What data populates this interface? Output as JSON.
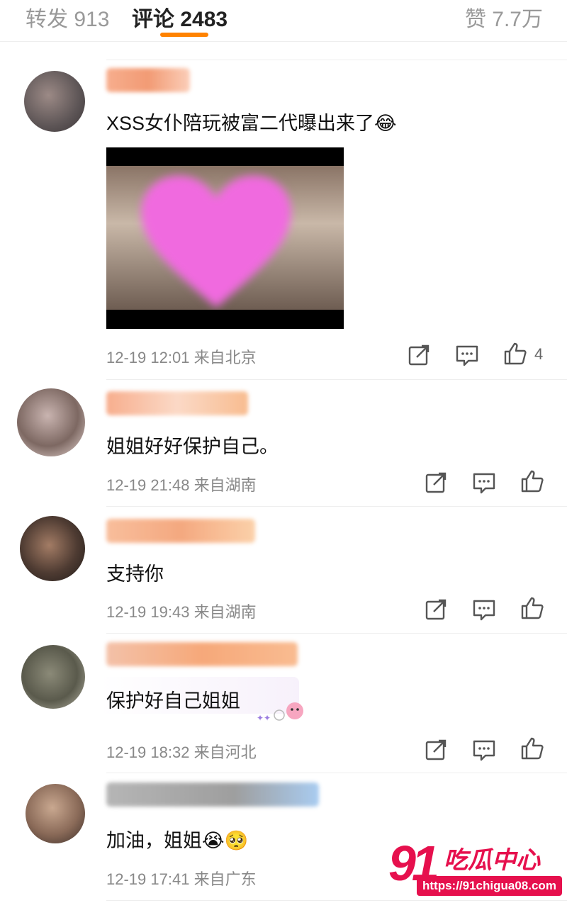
{
  "tabs": {
    "repost": "转发 913",
    "comments": "评论 2483",
    "likes": "赞 7.7万"
  },
  "comments": [
    {
      "text": "XSS女仆陪玩被富二代曝出来了😂",
      "time": "12-19 12:01",
      "location": "来自北京",
      "likes": "4"
    },
    {
      "text": "姐姐好好保护自己。",
      "time": "12-19 21:48",
      "location": "来自湖南",
      "likes": ""
    },
    {
      "text": "支持你",
      "time": "12-19 19:43",
      "location": "来自湖南",
      "likes": ""
    },
    {
      "text": "保护好自己姐姐",
      "time": "12-19 18:32",
      "location": "来自河北",
      "likes": ""
    },
    {
      "text": "加油，姐姐😭🥺",
      "time": "12-19 17:41",
      "location": "来自广东",
      "likes": ""
    }
  ],
  "icons": {
    "repost": "share-icon",
    "comment": "comment-icon",
    "like": "thumbs-up-icon"
  },
  "colors": {
    "accent": "#ff8200",
    "watermark": "#e6104d"
  },
  "watermark": {
    "number": "91",
    "title": "吃瓜中心",
    "url": "https://91chigua08.com"
  }
}
